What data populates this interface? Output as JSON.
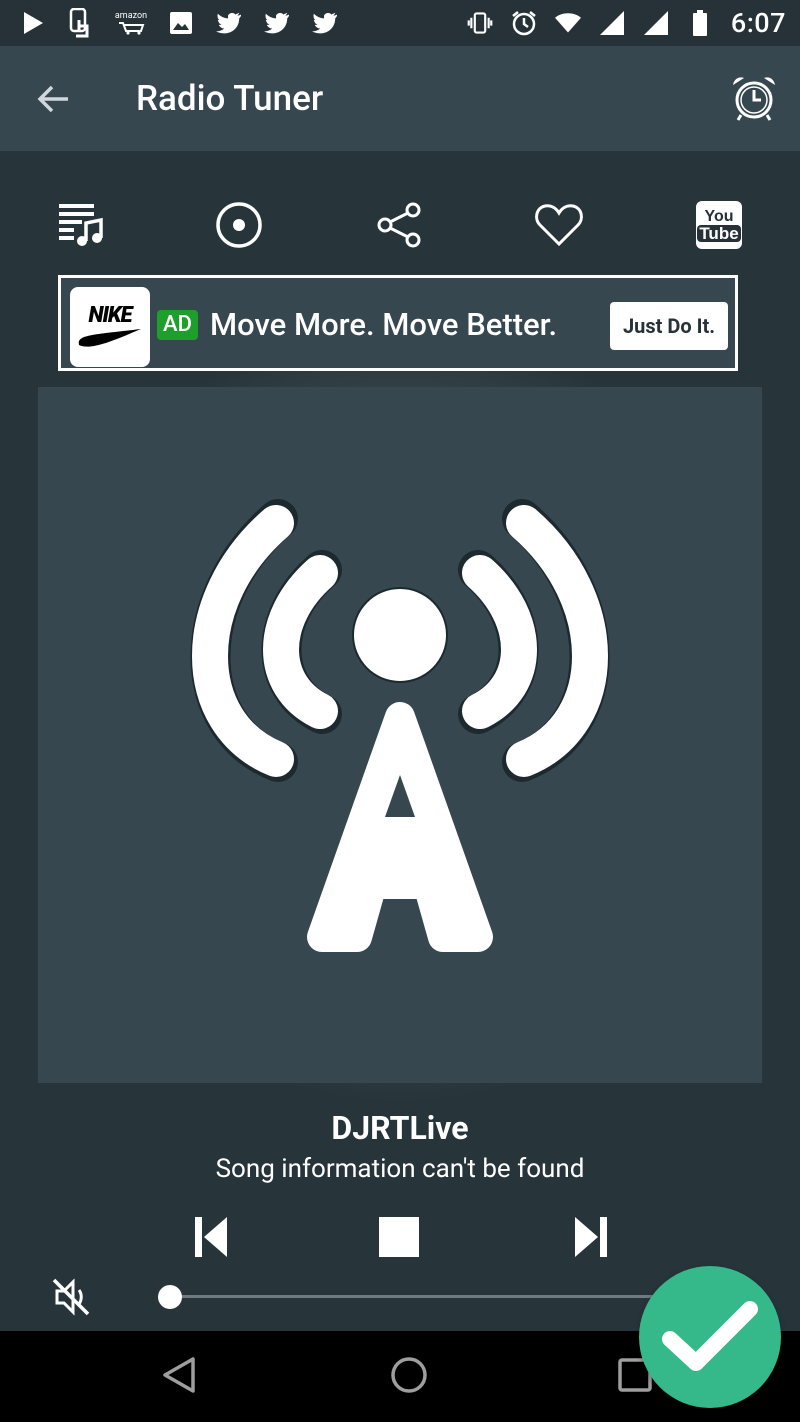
{
  "status_bar": {
    "time": "6:07",
    "left_icons": [
      "play-store-icon",
      "touch-icon",
      "amazon-icon",
      "image-icon",
      "twitter-icon",
      "twitter-icon",
      "twitter-icon"
    ],
    "right_icons": [
      "vibrate-icon",
      "alarm-icon",
      "wifi-icon",
      "signal-icon",
      "signal-icon",
      "battery-icon"
    ],
    "amazon_label": "amazon"
  },
  "app_bar": {
    "title": "Radio Tuner"
  },
  "toolbar": {
    "icons": [
      "playlist-icon",
      "record-icon",
      "share-icon",
      "favorite-heart-icon",
      "youtube-icon"
    ],
    "youtube_label_top": "You",
    "youtube_label_bottom": "Tube"
  },
  "ad": {
    "brand": "NIKE",
    "badge": "AD",
    "headline": "Move More. Move Better.",
    "cta": "Just Do It."
  },
  "now_playing": {
    "station": "DJRTLive",
    "song_info": "Song information can't be found",
    "volume": 0.0
  },
  "colors": {
    "app_bar": "#37474f",
    "background": "#27353b",
    "ad_badge": "#1e9e2a",
    "fab": "#35b88a"
  }
}
